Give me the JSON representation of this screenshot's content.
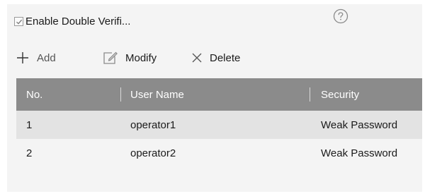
{
  "header": {
    "double_verify_label": "Enable Double Verifi...",
    "double_verify_checked": true
  },
  "toolbar": {
    "add_label": "Add",
    "modify_label": "Modify",
    "delete_label": "Delete"
  },
  "table": {
    "columns": [
      "No.",
      "User Name",
      "Security"
    ],
    "rows": [
      {
        "no": "1",
        "user": "operator1",
        "security": "Weak Password"
      },
      {
        "no": "2",
        "user": "operator2",
        "security": "Weak Password"
      }
    ]
  },
  "icons": {
    "help": "help-circle-icon",
    "add": "plus-icon",
    "modify": "edit-icon",
    "delete": "x-icon",
    "checkbox": "checkmark-icon"
  },
  "colors": {
    "header_bg": "#8b8b8b",
    "row_alt_bg": "#e3e3e3",
    "panel_bg": "#f4f4f4"
  }
}
